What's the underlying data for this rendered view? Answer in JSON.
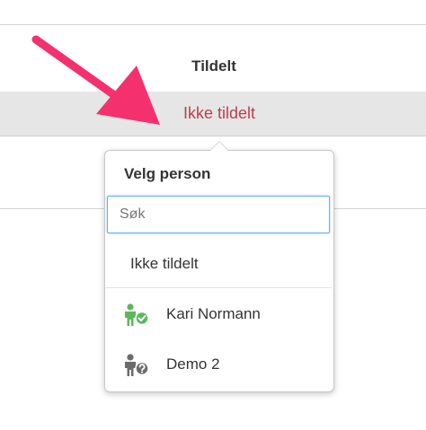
{
  "table": {
    "column_header": "Tildelt",
    "row_value": "Ikke tildelt"
  },
  "popover": {
    "title": "Velg person",
    "search_placeholder": "Søk",
    "unassigned_option": "Ikke tildelt",
    "people": [
      {
        "name": "Kari Normann",
        "icon": "person-check-icon",
        "badge_color": "#5cb85c",
        "figure_color": "#5cb85c"
      },
      {
        "name": "Demo 2",
        "icon": "person-question-icon",
        "badge_color": "#6b6b6b",
        "figure_color": "#6b6b6b"
      }
    ]
  },
  "colors": {
    "accent_red": "#b9404b",
    "annotation_arrow": "#f5306f",
    "focus_blue": "#66afe9"
  }
}
